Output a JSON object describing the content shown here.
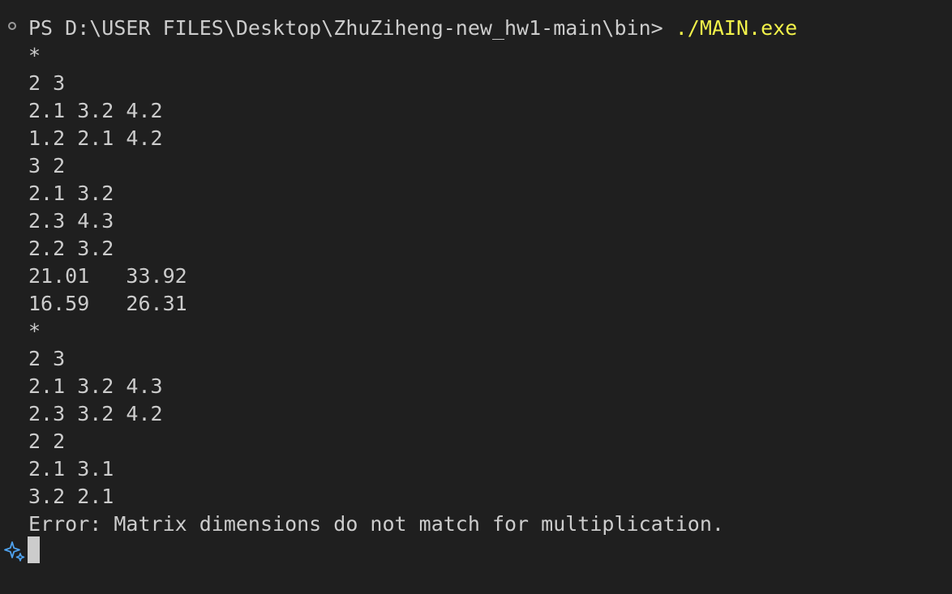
{
  "terminal": {
    "prompt": "PS D:\\USER FILES\\Desktop\\ZhuZiheng-new_hw1-main\\bin> ",
    "command": "./MAIN.exe",
    "lines": [
      "*",
      "2 3",
      "2.1 3.2 4.2",
      "1.2 2.1 4.2",
      "3 2",
      "2.1 3.2",
      "2.3 4.3",
      "2.2 3.2",
      "21.01   33.92",
      "16.59   26.31",
      "*",
      "2 3",
      "2.1 3.2 4.3",
      "2.3 3.2 4.2",
      "2 2",
      "2.1 3.1",
      "3.2 2.1",
      "Error: Matrix dimensions do not match for multiplication."
    ]
  },
  "icons": {
    "status": "status-circle-icon",
    "assistant": "sparkle-icon"
  },
  "colors": {
    "background": "#1f1f1f",
    "text": "#cccccc",
    "command": "#f2f24a",
    "sparkle": "#4fa3f0"
  }
}
